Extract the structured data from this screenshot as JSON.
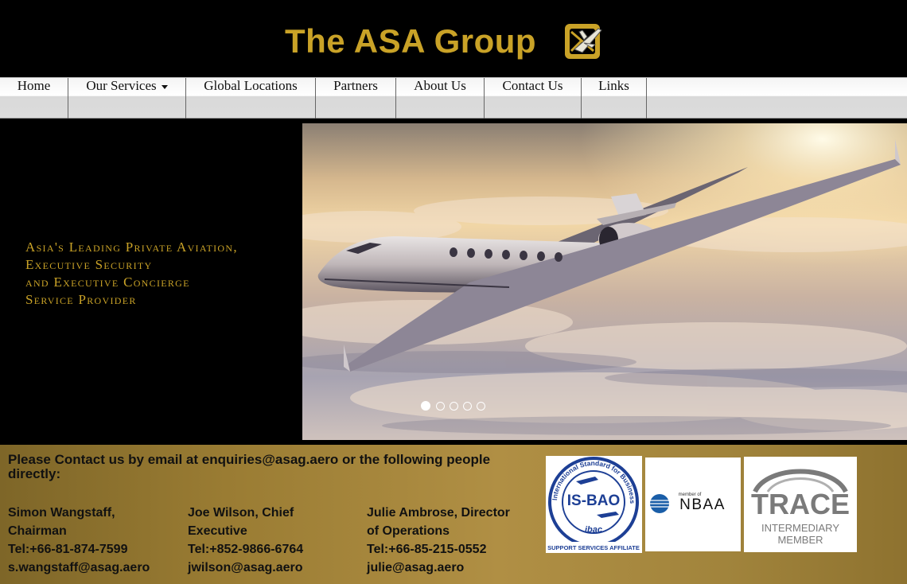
{
  "header": {
    "title": "The ASA Group",
    "logo_icon": "plane-on-envelope-icon",
    "title_color": "#c9a227"
  },
  "nav": {
    "items": [
      {
        "label": "Home"
      },
      {
        "label": "Our Services",
        "has_dropdown": true
      },
      {
        "label": "Global Locations"
      },
      {
        "label": "Partners"
      },
      {
        "label": "About Us"
      },
      {
        "label": "Contact Us"
      },
      {
        "label": "Links"
      }
    ]
  },
  "hero": {
    "tagline": [
      "Asia's Leading Private Aviation,",
      "Executive Security",
      "and Executive Concierge",
      "Service Provider"
    ],
    "slides_count": 5,
    "active_slide": 1
  },
  "contact": {
    "heading": "Please Contact us by email at enquiries@asag.aero or the following people directly:",
    "people": [
      {
        "name_lines": [
          "Simon Wangstaff,",
          "Chairman"
        ],
        "phone": "Tel:+66-81-874-7599",
        "email": "s.wangstaff@asag.aero"
      },
      {
        "name_lines": [
          "Joe Wilson, Chief",
          "Executive"
        ],
        "phone": "Tel:+852-9866-6764",
        "email": "jwilson@asag.aero"
      },
      {
        "name_lines": [
          "Julie Ambrose, Director",
          "of Operations"
        ],
        "phone": "Tel:+66-85-215-0552",
        "email": "julie@asag.aero"
      }
    ]
  },
  "badges": {
    "isbao": {
      "main": "IS-BAO",
      "ring": "International Standard for Business Aircraft Operations",
      "mid": "ibac",
      "footer": "SUPPORT SERVICES AFFILIATE"
    },
    "nbaa": {
      "small": "member of",
      "main": "NBAA"
    },
    "trace": {
      "main": "TRACE",
      "line1": "INTERMEDIARY",
      "line2": "MEMBER"
    }
  }
}
